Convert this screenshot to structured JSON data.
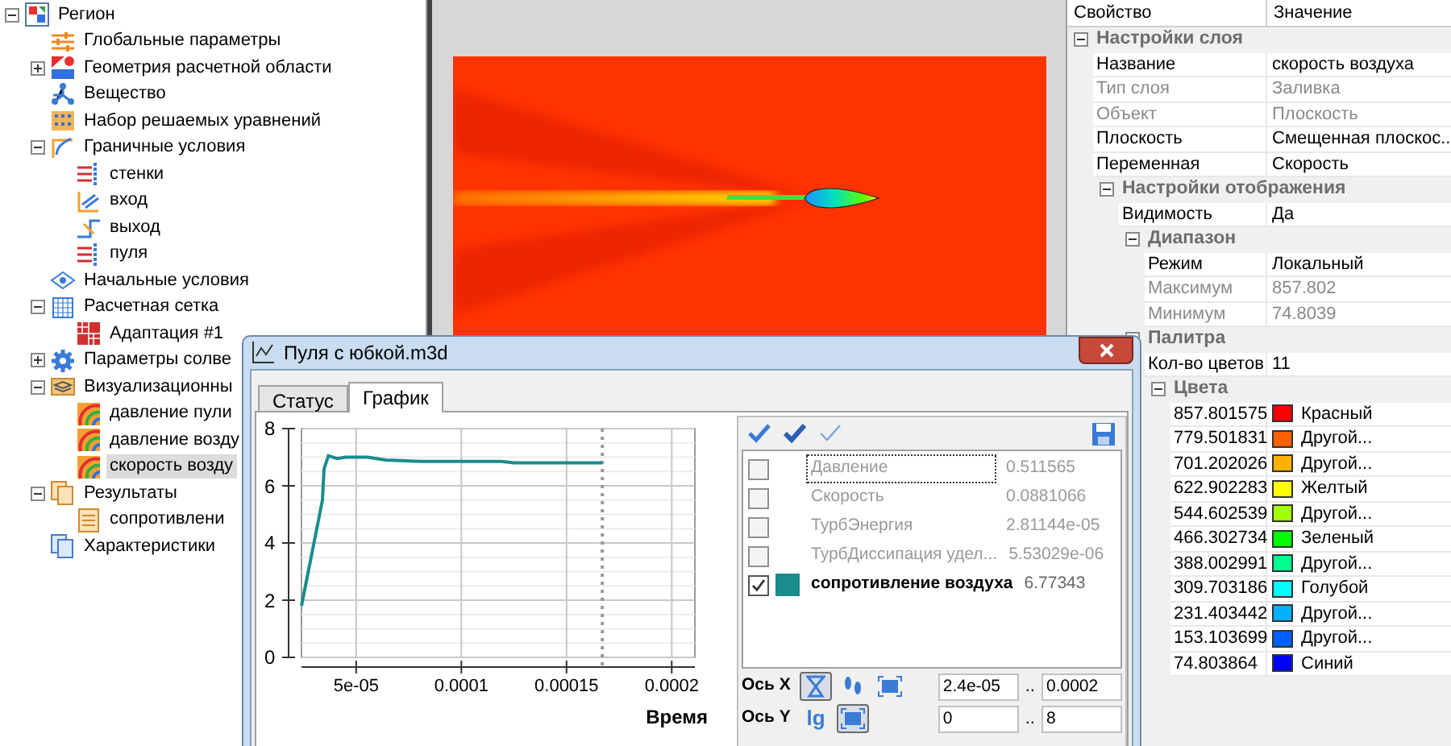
{
  "tree": [
    {
      "label": "Регион",
      "kind": "region",
      "expanded": true,
      "selected": false,
      "children": [
        {
          "label": "Глобальные параметры",
          "kind": "sliders",
          "selected": false
        },
        {
          "label": "Геометрия расчетной области",
          "kind": "geometry",
          "expanded": false,
          "selected": false
        },
        {
          "label": "Вещество",
          "kind": "substance",
          "selected": false
        },
        {
          "label": "Набор решаемых уравнений",
          "kind": "equations",
          "selected": false
        },
        {
          "label": "Граничные условия",
          "kind": "boundary",
          "expanded": true,
          "selected": false,
          "children": [
            {
              "label": "стенки",
              "kind": "walls",
              "selected": false
            },
            {
              "label": "вход",
              "kind": "inlet",
              "selected": false
            },
            {
              "label": "выход",
              "kind": "outlet",
              "selected": false
            },
            {
              "label": "пуля",
              "kind": "walls",
              "selected": false
            }
          ]
        },
        {
          "label": "Начальные условия",
          "kind": "initial",
          "selected": false
        },
        {
          "label": "Расчетная сетка",
          "kind": "mesh",
          "expanded": true,
          "selected": false,
          "children": [
            {
              "label": "Адаптация #1",
              "kind": "adaptation",
              "selected": false
            }
          ]
        },
        {
          "label": "Параметры солве",
          "kind": "solver",
          "expanded": false,
          "selected": false
        },
        {
          "label": "Визуализационны",
          "kind": "visualization",
          "expanded": true,
          "selected": false,
          "children": [
            {
              "label": "давление пули",
              "kind": "layer",
              "selected": false
            },
            {
              "label": "давление возду",
              "kind": "layer",
              "selected": false
            },
            {
              "label": "скорость возду",
              "kind": "layer",
              "selected": true
            }
          ]
        },
        {
          "label": "Результаты",
          "kind": "results",
          "expanded": true,
          "selected": false,
          "children": [
            {
              "label": "сопротивлени",
              "kind": "document",
              "selected": false
            }
          ]
        },
        {
          "label": "Характеристики",
          "kind": "characteristics",
          "selected": false
        }
      ]
    }
  ],
  "property_grid": {
    "columns": [
      "Свойство",
      "Значение"
    ],
    "categories": [
      {
        "name": "Настройки слоя",
        "expanded": true,
        "rows": [
          {
            "kind": "text",
            "name": "Название",
            "value": "скорость воздуха",
            "disabled": false
          },
          {
            "kind": "text",
            "name": "Тип слоя",
            "value": "Заливка",
            "disabled": true
          },
          {
            "kind": "text",
            "name": "Объект",
            "value": "Плоскость",
            "disabled": true
          },
          {
            "kind": "text",
            "name": "Плоскость",
            "value": "Смещенная плоскос...",
            "disabled": false
          },
          {
            "kind": "text",
            "name": "Переменная",
            "value": "Скорость",
            "disabled": false
          }
        ],
        "children": [
          {
            "name": "Настройки отображения",
            "expanded": true,
            "rows": [
              {
                "kind": "text",
                "name": "Видимость",
                "value": "Да",
                "disabled": false
              }
            ],
            "children": [
              {
                "name": "Диапазон",
                "expanded": true,
                "rows": [
                  {
                    "kind": "text",
                    "name": "Режим",
                    "value": "Локальный",
                    "disabled": false
                  },
                  {
                    "kind": "text",
                    "name": "Максимум",
                    "value": "857.802",
                    "disabled": true
                  },
                  {
                    "kind": "text",
                    "name": "Минимум",
                    "value": "74.8039",
                    "disabled": true
                  }
                ]
              },
              {
                "name": "Палитра",
                "expanded": true,
                "rows": [
                  {
                    "kind": "text",
                    "name": "Кол-во цветов",
                    "value": "11",
                    "disabled": false
                  }
                ],
                "children": [
                  {
                    "name": "Цвета",
                    "expanded": true,
                    "rows": [
                      {
                        "kind": "color",
                        "name": "857.801575",
                        "value": "Красный",
                        "color": "#ff0000"
                      },
                      {
                        "kind": "color",
                        "name": "779.501831",
                        "value": "Другой...",
                        "color": "#ff6000"
                      },
                      {
                        "kind": "color",
                        "name": "701.202026",
                        "value": "Другой...",
                        "color": "#ffb000"
                      },
                      {
                        "kind": "color",
                        "name": "622.902283",
                        "value": "Желтый",
                        "color": "#ffff00"
                      },
                      {
                        "kind": "color",
                        "name": "544.602539",
                        "value": "Другой...",
                        "color": "#a0ff00"
                      },
                      {
                        "kind": "color",
                        "name": "466.302734",
                        "value": "Зеленый",
                        "color": "#00ff00"
                      },
                      {
                        "kind": "color",
                        "name": "388.002991",
                        "value": "Другой...",
                        "color": "#00ff90"
                      },
                      {
                        "kind": "color",
                        "name": "309.703186",
                        "value": "Голубой",
                        "color": "#00ffff"
                      },
                      {
                        "kind": "color",
                        "name": "231.403442",
                        "value": "Другой...",
                        "color": "#00b0ff"
                      },
                      {
                        "kind": "color",
                        "name": "153.103699",
                        "value": "Другой...",
                        "color": "#0060ff"
                      },
                      {
                        "kind": "color",
                        "name": "74.803864",
                        "value": "Синий",
                        "color": "#0000ff"
                      }
                    ]
                  }
                ]
              }
            ]
          }
        ]
      }
    ]
  },
  "dialog": {
    "title": "Пуля с юбкой.m3d",
    "tabs": [
      {
        "label": "Статус",
        "selected": false
      },
      {
        "label": "График",
        "selected": true
      }
    ],
    "chart_data": {
      "type": "line",
      "xlabel": "Время",
      "x": [
        2.4e-05,
        3.4e-05,
        3.47e-05,
        3.68e-05,
        4.1e-05,
        4.5e-05,
        5.55e-05,
        6.4e-05,
        8.1e-05,
        0.000119,
        0.000125,
        0.000167
      ],
      "series": [
        {
          "color": "#1a8c8c",
          "values": [
            1.8,
            5.5,
            6.6,
            7.05,
            6.95,
            7.0,
            7.0,
            6.9,
            6.85,
            6.85,
            6.8,
            6.8
          ]
        }
      ],
      "xlim": [
        2.4e-05,
        0.000211
      ],
      "ylim": [
        0,
        8
      ],
      "xticks": [
        {
          "value": 5e-05,
          "label": "5e-05"
        },
        {
          "value": 0.0001,
          "label": "0.0001"
        },
        {
          "value": 0.00015,
          "label": "0.00015"
        },
        {
          "value": 0.0002,
          "label": "0.0002"
        }
      ],
      "yticks": [
        0,
        2,
        4,
        6,
        8
      ],
      "grid": true,
      "ref_lines": [
        {
          "axis": "x",
          "value": 0.000167
        }
      ]
    },
    "variables": [
      {
        "name": "Давление",
        "value": "0.511565",
        "checked": false,
        "focused": true
      },
      {
        "name": "Скорость",
        "value": "0.0881066",
        "checked": false,
        "focused": false
      },
      {
        "name": "ТурбЭнергия",
        "value": "2.81144e-05",
        "checked": false,
        "focused": false
      },
      {
        "name": "ТурбДиссипация удел...",
        "value": "5.53029e-06",
        "checked": false,
        "focused": false
      },
      {
        "name": "сопротивление воздуха",
        "value": "6.77343",
        "checked": true,
        "focused": false,
        "color": "#1a8c8c"
      }
    ],
    "axes": [
      {
        "label": "Ось X",
        "tools": [
          {
            "kind": "cursor",
            "pressed": true
          },
          {
            "kind": "steps",
            "pressed": false
          },
          {
            "kind": "fit",
            "pressed": false
          }
        ],
        "min": "2.4e-05",
        "separator": "..",
        "max": "0.0002"
      },
      {
        "label": "Ось Y",
        "tools": [
          {
            "kind": "log",
            "text": "lg",
            "pressed": false
          },
          {
            "kind": "fit",
            "pressed": true
          }
        ],
        "min": "0",
        "separator": "..",
        "max": "8"
      }
    ]
  }
}
